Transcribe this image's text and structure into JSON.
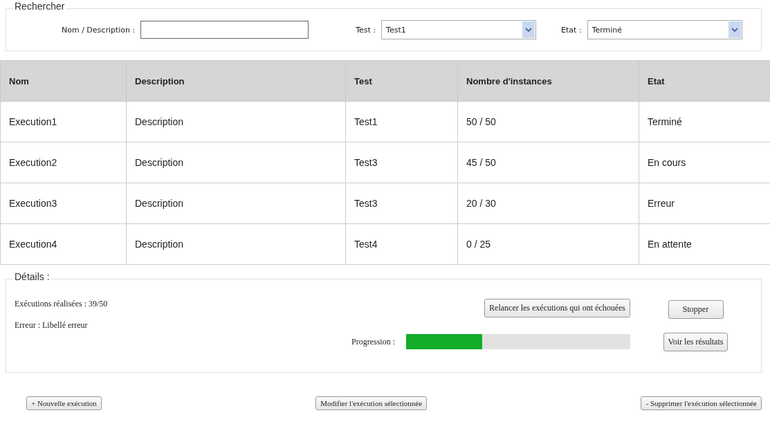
{
  "search": {
    "legend": "Rechercher",
    "name_label": "Nom / Description :",
    "test_label": "Test :",
    "test_value": "Test1",
    "state_label": "Etat :",
    "state_value": "Terminé"
  },
  "table": {
    "columns": [
      "Nom",
      "Description",
      "Test",
      "Nombre d'instances",
      "Etat"
    ],
    "rows": [
      [
        "Execution1",
        "Description",
        "Test1",
        "50 / 50",
        "Terminé"
      ],
      [
        "Execution2",
        "Description",
        "Test3",
        "45 / 50",
        "En cours"
      ],
      [
        "Execution3",
        "Description",
        "Test3",
        "20 / 30",
        "Erreur"
      ],
      [
        "Execution4",
        "Description",
        "Test4",
        "0 / 25",
        "En attente"
      ]
    ]
  },
  "details": {
    "legend": "Détails :",
    "done": "Exécutions réalisées : 39/50",
    "error": "Erreur : Libellé erreur",
    "relaunch_button": "Relancer les exécutions qui ont échouées",
    "stop_button": "Stopper",
    "progress_label": "Progression :",
    "progress": {
      "level": 0.34
    },
    "results_button": "Voir les résultats"
  },
  "actions": [
    "+ Nouvelle exécution",
    "Modifier l'exécution sélectionnée",
    "- Supprimer l'exécution sélectionnée"
  ]
}
